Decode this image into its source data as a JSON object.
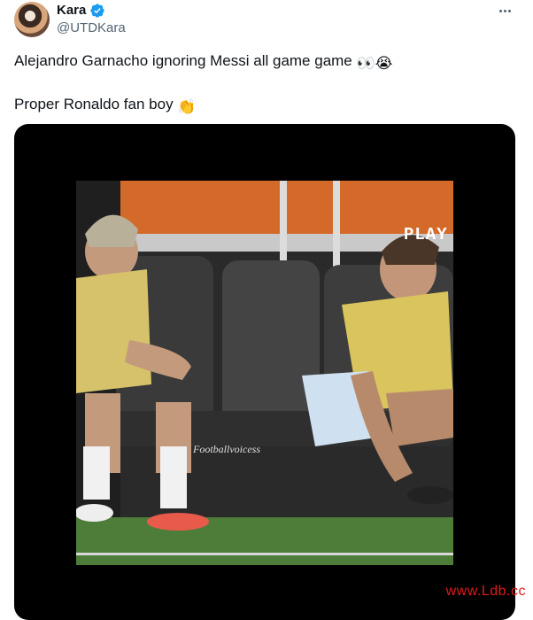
{
  "tweet": {
    "display_name": "Kara",
    "handle": "@UTDKara",
    "line1": "Alejandro Garnacho ignoring Messi all game game",
    "line1_emojis": "👀😭",
    "line2": "Proper Ronaldo fan boy",
    "line2_emoji": "👏",
    "verified_color": "#1d9bf0"
  },
  "media": {
    "overlay_label": "PLAY",
    "video_watermark": "Footballvoicess"
  },
  "page_watermark": "www.Ldb.cc",
  "icons": [
    "verified-badge-icon",
    "more-options-icon",
    "play-triangle-icon"
  ]
}
